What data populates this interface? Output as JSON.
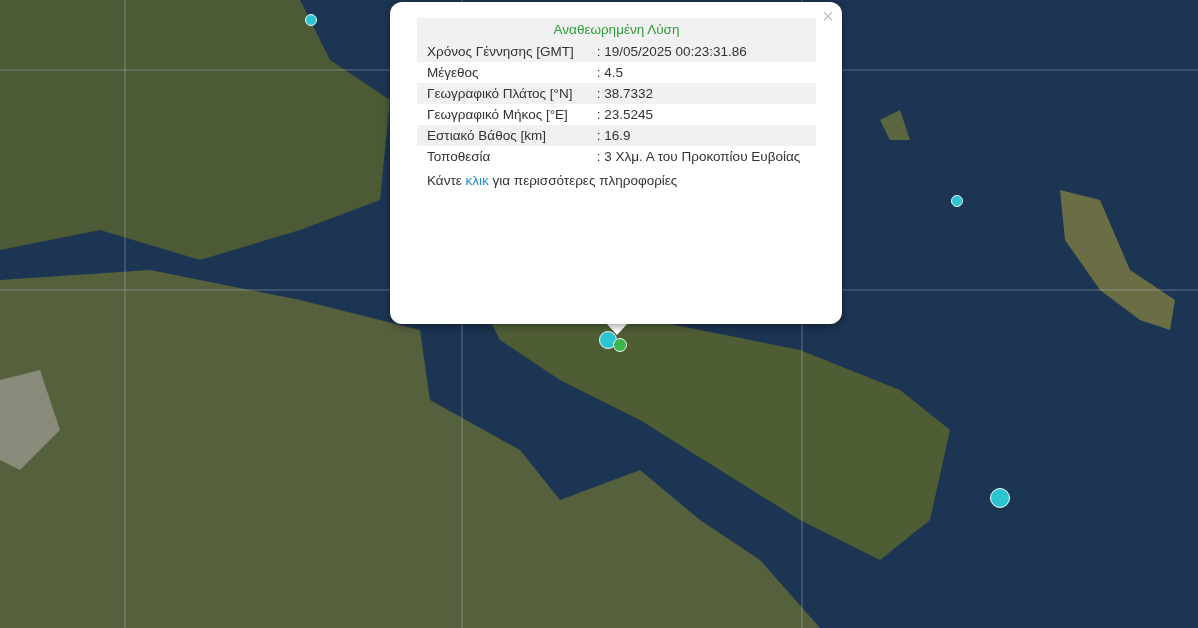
{
  "popup": {
    "close": "×",
    "title": "Αναθεωρημένη Λύση",
    "rows": [
      {
        "label": "Χρόνος Γέννησης [GMT]",
        "value": ": 19/05/2025 00:23:31.86"
      },
      {
        "label": "Μέγεθος",
        "value": ": 4.5"
      },
      {
        "label": "Γεωγραφικό Πλάτος [°N]",
        "value": ": 38.7332"
      },
      {
        "label": "Γεωγραφικό Μήκος [°E]",
        "value": ": 23.5245"
      },
      {
        "label": "Εστιακό Βάθος [km]",
        "value": ": 16.9"
      },
      {
        "label": "Τοποθεσία",
        "value": ": 3 Χλμ. Α του Προκοπίου Ευβοίας"
      }
    ],
    "footer": {
      "before": "Κάντε",
      "link": "κλικ",
      "after": "για περισσότερες πληροφορίες"
    }
  },
  "markers": [
    {
      "color": "#2bc4d0"
    },
    {
      "color": "#2bc4d0"
    },
    {
      "color": "#2bc4d0"
    },
    {
      "color": "#2bc4d0"
    },
    {
      "color": "#3cb44a"
    }
  ]
}
